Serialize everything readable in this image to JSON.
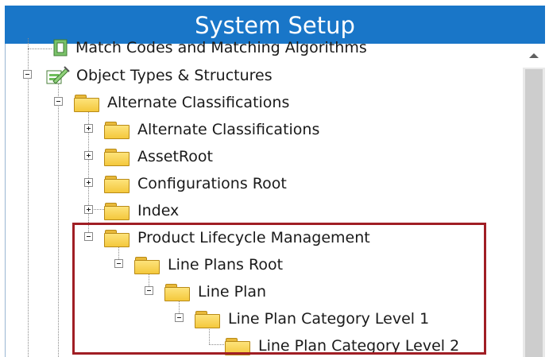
{
  "window": {
    "title": "System Setup"
  },
  "tree": {
    "items": [
      {
        "label": "Match Codes and Matching Algorithms",
        "icon": "match-codes-icon",
        "expander": "none"
      },
      {
        "label": "Object Types & Structures",
        "icon": "object-types-icon",
        "expander": "minus"
      },
      {
        "label": "Alternate Classifications",
        "icon": "folder-icon",
        "expander": "minus"
      },
      {
        "label": "Alternate Classifications",
        "icon": "folder-icon",
        "expander": "plus"
      },
      {
        "label": "AssetRoot",
        "icon": "folder-icon",
        "expander": "plus"
      },
      {
        "label": "Configurations Root",
        "icon": "folder-icon",
        "expander": "plus"
      },
      {
        "label": "Index",
        "icon": "folder-icon",
        "expander": "plus"
      },
      {
        "label": "Product Lifecycle Management",
        "icon": "folder-icon",
        "expander": "minus"
      },
      {
        "label": "Line Plans Root",
        "icon": "folder-icon",
        "expander": "minus"
      },
      {
        "label": "Line Plan",
        "icon": "folder-icon",
        "expander": "minus"
      },
      {
        "label": "Line Plan Category Level 1",
        "icon": "folder-icon",
        "expander": "minus"
      },
      {
        "label": "Line Plan Category Level 2",
        "icon": "folder-icon",
        "expander": "none"
      }
    ]
  },
  "colors": {
    "title_bar": "#1976c8",
    "highlight_box": "#a01e24"
  }
}
